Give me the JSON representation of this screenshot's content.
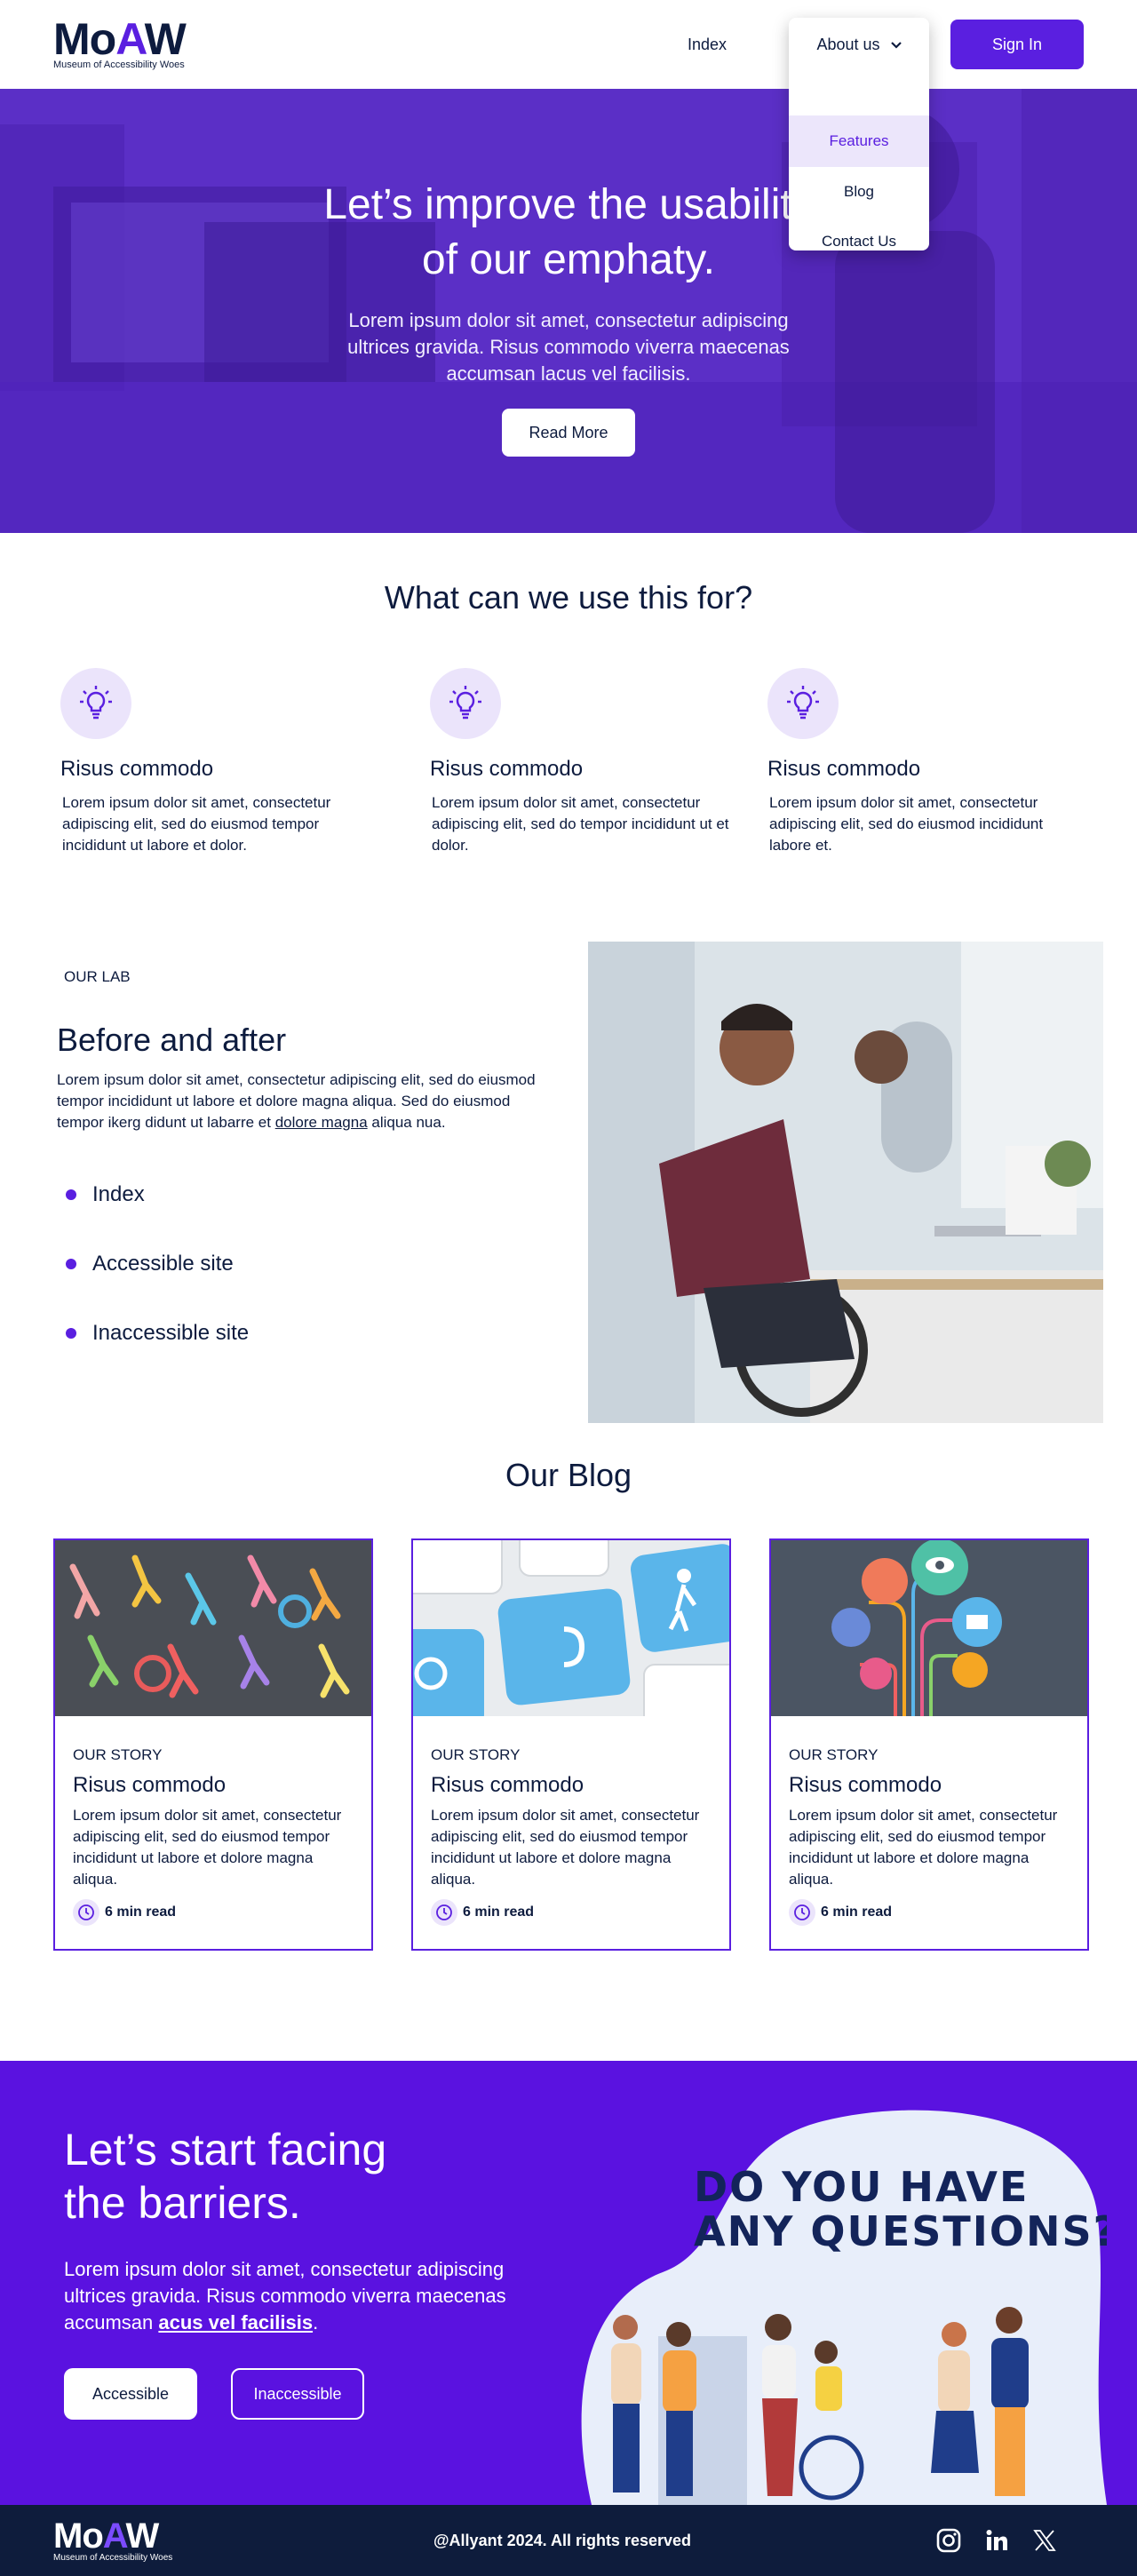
{
  "header": {
    "logo_text": "MoAW",
    "logo_tagline": "Museum of Accessibility Woes",
    "nav_index": "Index",
    "nav_about": "About us",
    "dropdown": [
      "Features",
      "Blog",
      "Contact Us"
    ],
    "signin": "Sign In"
  },
  "hero": {
    "title_line1": "Let’s improve the usability",
    "title_line2": "of our emphaty.",
    "text": "Lorem ipsum dolor sit amet, consectetur adipiscing ultrices gravida. Risus commodo viverra maecenas accumsan lacus vel facilisis.",
    "button": "Read More"
  },
  "features": {
    "title": "What can we use this for?",
    "items": [
      {
        "title": "Risus commodo",
        "text": "Lorem ipsum dolor sit amet, consectetur adipiscing elit, sed do eiusmod tempor incididunt ut labore et dolor."
      },
      {
        "title": "Risus commodo",
        "text": "Lorem ipsum dolor sit amet, consectetur adipiscing elit, sed do tempor incididunt ut et dolor."
      },
      {
        "title": "Risus commodo",
        "text": "Lorem ipsum dolor sit amet, consectetur adipiscing elit, sed do eiusmod incididunt labore et."
      }
    ]
  },
  "lab": {
    "eyebrow": "OUR LAB",
    "title": "Before and after",
    "text_before": "Lorem ipsum dolor sit amet, consectetur adipiscing elit, sed do eiusmod tempor incididunt ut labore et dolore magna aliqua. Sed do eiusmod tempor ikerg didunt ut labarre et ",
    "text_link": "dolore magna",
    "text_after": " aliqua nua.",
    "list": [
      "Index",
      "Accessible site",
      "Inaccessible site"
    ]
  },
  "blog": {
    "title": "Our Blog",
    "cards": [
      {
        "eyebrow": "OUR STORY",
        "title": "Risus commodo",
        "text": "Lorem ipsum dolor sit amet, consectetur adipiscing elit, sed do eiusmod tempor incididunt ut labore et dolore magna aliqua.",
        "read": "6 min read"
      },
      {
        "eyebrow": "OUR STORY",
        "title": "Risus commodo",
        "text": "Lorem ipsum dolor sit amet, consectetur adipiscing elit, sed do eiusmod tempor incididunt ut labore et dolore magna aliqua.",
        "read": "6 min read"
      },
      {
        "eyebrow": "OUR STORY",
        "title": "Risus commodo",
        "text": "Lorem ipsum dolor sit amet, consectetur adipiscing elit, sed do eiusmod tempor incididunt ut labore et dolore magna aliqua.",
        "read": "6 min read"
      }
    ]
  },
  "cta": {
    "title_line1": "Let’s start facing",
    "title_line2": "the barriers.",
    "text_before": "Lorem ipsum dolor sit amet, consectetur adipiscing ultrices gravida. Risus commodo viverra maecenas accumsan ",
    "text_link": "acus vel facilisis",
    "text_after": ".",
    "btn_accessible": "Accessible",
    "btn_inaccessible": "Inaccessible",
    "bubble_line1": "DO YOU HAVE",
    "bubble_line2": "ANY QUESTIONS?"
  },
  "footer": {
    "logo_text": "MoAW",
    "logo_tagline": "Museum of Accessibility Woes",
    "copyright": "@Allyant 2024. All rights reserved",
    "socials": [
      "instagram-icon",
      "linkedin-icon",
      "x-icon"
    ]
  },
  "colors": {
    "brand": "#5a1fe0",
    "navy": "#0e1c3c",
    "lavender": "#ebe4fb"
  }
}
